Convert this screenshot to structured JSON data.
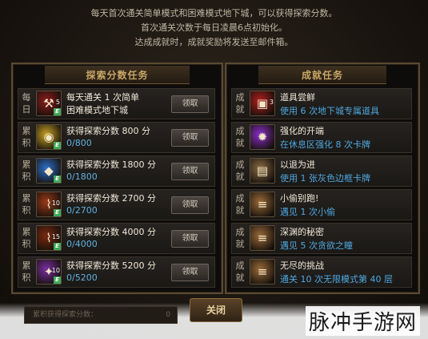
{
  "header": {
    "line1": "每天首次通关简单模式和困难模式地下城，可以获得探索分数。",
    "line2": "首次通关次数于每日凌晨6点初始化。",
    "line3": "达成成就时，成就奖励将发送至邮件箱。"
  },
  "explore_panel": {
    "title": "探索分数任务",
    "rows": [
      {
        "type": "每日",
        "icon": "axe-icon",
        "icon_color": "#8a1d1d",
        "num": "5",
        "title": "每天通关 1 次简单",
        "sub": "困难模式地下城",
        "sub_is_title": true,
        "button": "领取"
      },
      {
        "type": "累积",
        "icon": "coin-pot-icon",
        "icon_color": "#c9a227",
        "num": "",
        "title": "获得探索分数 800 分",
        "sub": "0/800",
        "button": "领取"
      },
      {
        "type": "累积",
        "icon": "gem-bag-icon",
        "icon_color": "#2f6fc9",
        "num": "",
        "title": "获得探索分数 1800 分",
        "sub": "0/1800",
        "button": "领取"
      },
      {
        "type": "累积",
        "icon": "boots-icon",
        "icon_color": "#9a3a1a",
        "num": "10",
        "title": "获得探索分数 2700 分",
        "sub": "0/2700",
        "button": "领取"
      },
      {
        "type": "累积",
        "icon": "boots-icon",
        "icon_color": "#7a2a12",
        "num": "15",
        "title": "获得探索分数 4000 分",
        "sub": "0/4000",
        "button": "领取"
      },
      {
        "type": "累积",
        "icon": "rune-stone-icon",
        "icon_color": "#7a2fa0",
        "num": "10",
        "title": "获得探索分数 5200 分",
        "sub": "0/5200",
        "button": "领取"
      }
    ]
  },
  "achievement_panel": {
    "title": "成就任务",
    "rows": [
      {
        "type": "成就",
        "icon": "chest-icon",
        "icon_color": "#b02020",
        "num": "3",
        "title": "道具尝鲜",
        "sub": "使用 6 次地下城专属道具"
      },
      {
        "type": "成就",
        "icon": "orb-icon",
        "icon_color": "#8a2fc9",
        "num": "",
        "title": "强化的开端",
        "sub": "在休息区强化 8 次卡牌"
      },
      {
        "type": "成就",
        "icon": "card-icon",
        "icon_color": "#8a6a45",
        "num": "",
        "title": "以退为进",
        "sub": "使用 1 张灰色边框卡牌"
      },
      {
        "type": "成就",
        "icon": "scroll-icon",
        "icon_color": "#9a6a3a",
        "num": "",
        "title": "小偷别跑!",
        "sub": "遇见 1 次小偷"
      },
      {
        "type": "成就",
        "icon": "scroll-icon",
        "icon_color": "#9a6a3a",
        "num": "",
        "title": "深渊的秘密",
        "sub": "遇见 5 次贪欲之瞳"
      },
      {
        "type": "成就",
        "icon": "scroll-icon",
        "icon_color": "#9a6a3a",
        "num": "",
        "title": "无尽的挑战",
        "sub": "通关 10 次无限模式第 40 层"
      }
    ]
  },
  "footer": {
    "label": "累积获得探索分数：",
    "value": "0",
    "close_button": "关闭"
  },
  "watermark": "脉冲手游网",
  "colors": {
    "accent": "#c9a766",
    "progress": "#5fb0e0"
  }
}
